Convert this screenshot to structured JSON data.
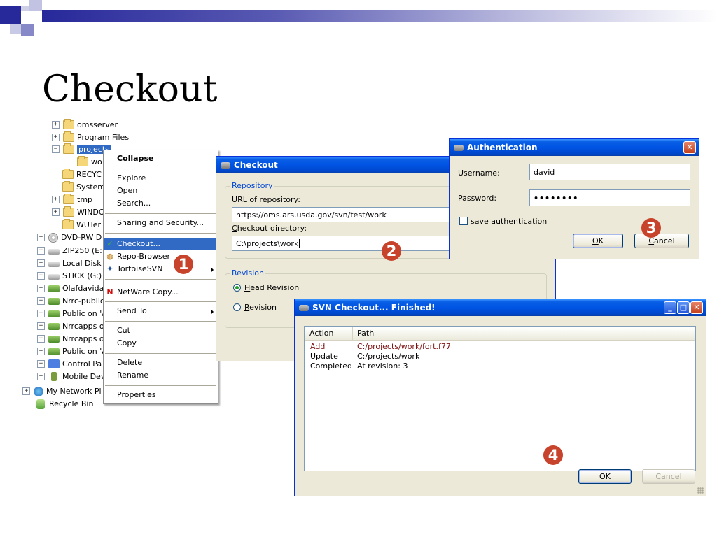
{
  "slide": {
    "title": "Checkout"
  },
  "tree": {
    "items": [
      {
        "label": "omsserver"
      },
      {
        "label": "Program Files"
      },
      {
        "label": "projects"
      },
      {
        "label": "wo"
      },
      {
        "label": "RECYC"
      },
      {
        "label": "System"
      },
      {
        "label": "tmp"
      },
      {
        "label": "WINDO"
      },
      {
        "label": "WUTer"
      },
      {
        "label": "DVD-RW D"
      },
      {
        "label": "ZIP250 (E:"
      },
      {
        "label": "Local Disk ("
      },
      {
        "label": "STICK (G:)"
      },
      {
        "label": "Olafdavida"
      },
      {
        "label": "Nrrc-public"
      },
      {
        "label": "Public on 'A"
      },
      {
        "label": "Nrrcapps o"
      },
      {
        "label": "Nrrcapps o"
      },
      {
        "label": "Public on 'A"
      },
      {
        "label": "Control Pa"
      },
      {
        "label": "Mobile Dev"
      },
      {
        "label": "My Network Pl"
      },
      {
        "label": "Recycle Bin"
      }
    ]
  },
  "context_menu": {
    "items": [
      {
        "label": "Collapse"
      },
      {
        "label": "Explore"
      },
      {
        "label": "Open"
      },
      {
        "label": "Search..."
      },
      {
        "label": "Sharing and Security..."
      },
      {
        "label": "Checkout..."
      },
      {
        "label": "Repo-Browser"
      },
      {
        "label": "TortoiseSVN"
      },
      {
        "label": "NetWare Copy..."
      },
      {
        "label": "Send To"
      },
      {
        "label": "Cut"
      },
      {
        "label": "Copy"
      },
      {
        "label": "Delete"
      },
      {
        "label": "Rename"
      },
      {
        "label": "Properties"
      }
    ]
  },
  "checkout_dialog": {
    "title": "Checkout",
    "repository_group": "Repository",
    "url_label_u": "U",
    "url_label_rest": "RL of repository:",
    "url_value": "https://oms.ars.usda.gov/svn/test/work",
    "dir_label_u": "C",
    "dir_label_rest": "heckout directory:",
    "dir_value": "C:\\projects\\work",
    "revision_group": "Revision",
    "head_u": "H",
    "head_rest": "ead Revision",
    "rev_u": "R",
    "rev_rest": "evision"
  },
  "auth_dialog": {
    "title": "Authentication",
    "username_label": "Username:",
    "username_value": "david",
    "password_label": "Password:",
    "password_value": "••••••••",
    "save_label": "save authentication",
    "ok_u": "O",
    "ok_rest": "K",
    "cancel_u": "C",
    "cancel_rest": "ancel"
  },
  "finished_dialog": {
    "title": "SVN Checkout... Finished!",
    "columns": [
      "Action",
      "Path"
    ],
    "rows": [
      {
        "action": "Add",
        "path": "C:/projects/work/fort.f77"
      },
      {
        "action": "Update",
        "path": "C:/projects/work"
      },
      {
        "action": "Completed",
        "path": "At revision: 3"
      }
    ],
    "ok_u": "O",
    "ok_rest": "K",
    "cancel_u": "C",
    "cancel_rest": "ancel"
  },
  "badges": {
    "one": "1",
    "two": "2",
    "three": "3",
    "four": "4"
  },
  "colors": {
    "accent": "#316ac5",
    "badge": "#c8432b",
    "titlebar": "#0054e3",
    "add_row": "#7b1010"
  }
}
